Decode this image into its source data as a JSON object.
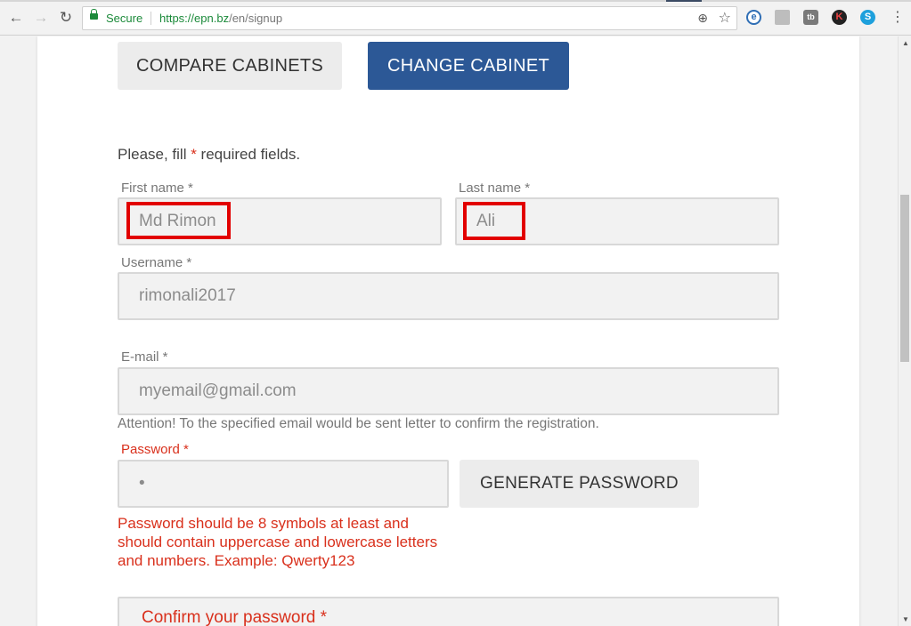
{
  "browser": {
    "secure_label": "Secure",
    "url_proto": "https://",
    "url_host": "epn.bz",
    "url_path": "/en/signup",
    "back_icon": "←",
    "forward_icon": "→",
    "reload_icon": "↻",
    "zoom_icon": "⊕",
    "star_icon": "☆",
    "menu_icon": "⋮",
    "extensions": [
      {
        "name": "e-extension-icon",
        "glyph": "e"
      },
      {
        "name": "save-extension-icon",
        "glyph": ""
      },
      {
        "name": "tb-extension-icon",
        "glyph": "tb"
      },
      {
        "name": "k-extension-icon",
        "glyph": "K"
      },
      {
        "name": "skype-icon",
        "glyph": "S"
      }
    ]
  },
  "header": {
    "compare_label": "COMPARE CABINETS",
    "change_label": "CHANGE CABINET"
  },
  "form": {
    "intro_before": "Please, fill ",
    "intro_star": "*",
    "intro_after": " required fields.",
    "first_name_label": "First name *",
    "first_name_value": "Md Rimon",
    "last_name_label": "Last name *",
    "last_name_value": "Ali",
    "username_label": "Username *",
    "username_value": "rimonali2017",
    "email_label": "E-mail *",
    "email_value": "myemail@gmail.com",
    "email_note": "Attention! To the specified email would be sent letter to confirm the registration.",
    "password_label": "Password *",
    "password_value": "•",
    "generate_label": "GENERATE PASSWORD",
    "password_hint": "Password should be 8 symbols at least and should contain uppercase and lowercase letters and numbers. Example: Qwerty123",
    "confirm_label": "Confirm your password *"
  },
  "colors": {
    "accent": "#2c5896",
    "error": "#d9301c",
    "highlight": "#e20000"
  }
}
